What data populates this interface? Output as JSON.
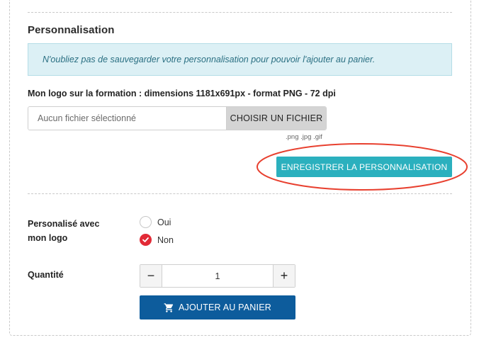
{
  "section": {
    "title": "Personnalisation"
  },
  "info": {
    "message": "N'oubliez pas de sauvegarder votre personnalisation pour pouvoir l'ajouter au panier."
  },
  "logo_upload": {
    "label": "Mon logo sur la formation : dimensions 1181x691px - format PNG - 72 dpi",
    "file_name": "Aucun fichier sélectionné",
    "choose_button": "CHOISIR UN FICHIER",
    "allowed_formats": ".png .jpg .gif"
  },
  "save_button": {
    "label": "ENREGISTRER LA PERSONNALISATION"
  },
  "personalized": {
    "label": "Personalisé avec mon logo",
    "options": [
      {
        "label": "Oui",
        "selected": false
      },
      {
        "label": "Non",
        "selected": true
      }
    ]
  },
  "quantity": {
    "label": "Quantité",
    "value": "1",
    "minus": "−",
    "plus": "+"
  },
  "cart_button": {
    "label": "AJOUTER AU PANIER"
  },
  "colors": {
    "save_button": "#2bb0be",
    "cart_button": "#0d5c9c",
    "radio_checked": "#e22a36",
    "highlight": "#e8402f",
    "info_bg": "#dcf0f5"
  }
}
